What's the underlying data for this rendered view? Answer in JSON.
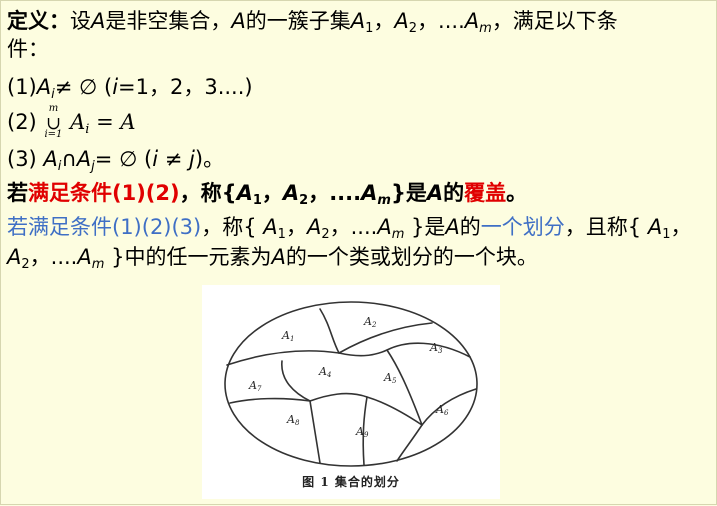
{
  "definition": {
    "label": "定义：",
    "text_1": "设",
    "A": "A",
    "text_2": "是非空集合，",
    "text_3": "的一簇子集",
    "A1": "A",
    "sub1": "1",
    "sep1": "，",
    "A2": "A",
    "sub2": "2",
    "dots": "，....",
    "Am": "A",
    "subm": "m",
    "text_4": "，满足以下条",
    "line2": "件："
  },
  "conditions": {
    "c1_prefix": "(1)",
    "c1_Ai": "A",
    "c1_sub": "i",
    "c1_neq": "≠ ∅ (",
    "c1_i": "i",
    "c1_tail": "=1，2，3....)",
    "c2_prefix": "(2)",
    "c2_union_top": "m",
    "c2_union": "∪",
    "c2_union_bottom": "i=1",
    "c2_body": "A",
    "c2_sub": "i",
    "c2_tail": " = A",
    "c3_prefix": "(3) ",
    "c3_Ai": "A",
    "c3_sub_i": "i",
    "c3_cap": "∩",
    "c3_Aj": "A",
    "c3_sub_j": "j",
    "c3_eq": "= ∅  (",
    "c3_i": "i",
    "c3_neq": " ≠ ",
    "c3_j": "j",
    "c3_tail": ")。"
  },
  "cover": {
    "prefix": "若",
    "red": "满足条件(1)(2)",
    "mid": "，称{",
    "A1": "A",
    "sub1": "1",
    "sep1": "，",
    "A2": "A",
    "sub2": "2",
    "dots": "，....",
    "Am": "A",
    "subm": "m",
    "close": "}是",
    "A": "A",
    "of": "的",
    "red_term": "覆盖",
    "end": "。"
  },
  "partition": {
    "blue_prefix": "若满足条件(1)(2)(3)",
    "mid": "，称{ ",
    "A1": "A",
    "sub1": "1",
    "sep1": "，",
    "A2": "A",
    "sub2": "2",
    "dots": "，....",
    "Am": "A",
    "subm": "m",
    "close": " }是",
    "A": "A",
    "of": "的",
    "blue_term": "一个划分",
    "tail": "，且称{ ",
    "A1b": "A",
    "sub1b": "1",
    "sepb": "，",
    "l2_A2": "A",
    "l2_sub2": "2",
    "l2_dots": "，....",
    "l2_Am": "A",
    "l2_subm": "m",
    "l2_text": " }中的任一元素为",
    "l2_A": "A",
    "l2_end": "的一个类或划分的一个块。"
  },
  "figure": {
    "caption": "图 1   集合的划分",
    "region_labels": [
      "A1",
      "A2",
      "A3",
      "A4",
      "A5",
      "A6",
      "A7",
      "A8",
      "A9"
    ]
  }
}
